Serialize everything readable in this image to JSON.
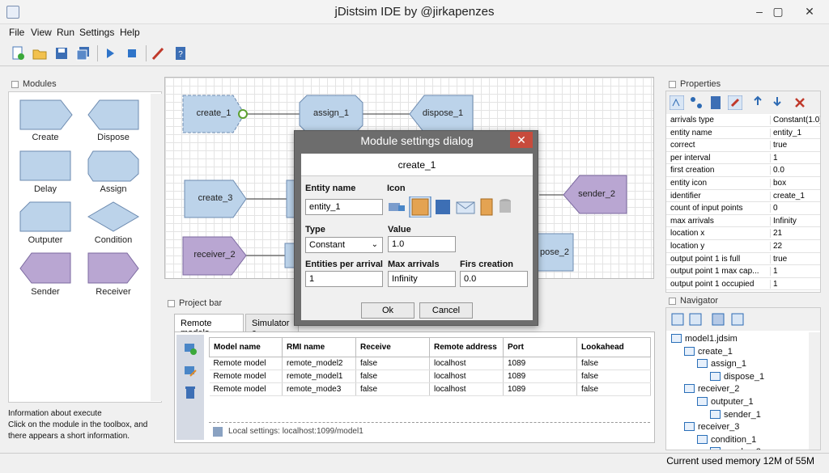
{
  "window": {
    "title": "jDistsim IDE by @jirkapenzes"
  },
  "menu": [
    "File",
    "View",
    "Run",
    "Settings",
    "Help"
  ],
  "modules_panel": {
    "title": "Modules",
    "items": [
      "Create",
      "Dispose",
      "Delay",
      "Assign",
      "Outputer",
      "Condition",
      "Sender",
      "Receiver"
    ]
  },
  "info": {
    "line1": "Information about execute",
    "line2": "Click on the module in the toolbox, and",
    "line3": "there appears a short information."
  },
  "canvas": {
    "nodes": [
      "create_1",
      "assign_1",
      "dispose_1",
      "create_3",
      "sender_2",
      "receiver_2",
      "pose_2"
    ]
  },
  "project_bar": {
    "title": "Project bar",
    "tabs": [
      "Remote models",
      "Simulator c"
    ],
    "table": {
      "headers": [
        "Model name",
        "RMI name",
        "Receive",
        "Remote address",
        "Port",
        "Lookahead"
      ],
      "rows": [
        [
          "Remote model",
          "remote_model2",
          "false",
          "localhost",
          "1089",
          "false"
        ],
        [
          "Remote model",
          "remote_model1",
          "false",
          "localhost",
          "1089",
          "false"
        ],
        [
          "Remote model",
          "remote_mode3",
          "false",
          "localhost",
          "1089",
          "false"
        ]
      ]
    },
    "local_settings": "Local settings: localhost:1099/model1"
  },
  "properties": {
    "title": "Properties",
    "rows": [
      [
        "arrivals type",
        "Constant(1.0)"
      ],
      [
        "entity name",
        "entity_1"
      ],
      [
        "correct",
        "true"
      ],
      [
        "per interval",
        "1"
      ],
      [
        "first creation",
        "0.0"
      ],
      [
        "entity icon",
        "box"
      ],
      [
        "identifier",
        "create_1"
      ],
      [
        "count of input points",
        "0"
      ],
      [
        "max arrivals",
        "Infinity"
      ],
      [
        "location x",
        "21"
      ],
      [
        "location y",
        "22"
      ],
      [
        "output point 1 is full",
        "true"
      ],
      [
        "output point 1 max cap...",
        "1"
      ],
      [
        "output point 1 occupied",
        "1"
      ]
    ]
  },
  "navigator": {
    "title": "Navigator",
    "tree": [
      {
        "label": "model1.jdsim",
        "level": 0
      },
      {
        "label": "create_1",
        "level": 1
      },
      {
        "label": "assign_1",
        "level": 2
      },
      {
        "label": "dispose_1",
        "level": 3
      },
      {
        "label": "receiver_2",
        "level": 1
      },
      {
        "label": "outputer_1",
        "level": 2
      },
      {
        "label": "sender_1",
        "level": 3
      },
      {
        "label": "receiver_3",
        "level": 1
      },
      {
        "label": "condition_1",
        "level": 2
      },
      {
        "label": "sender_2",
        "level": 3
      }
    ]
  },
  "status": {
    "memory": "Current used memory 12M of 55M"
  },
  "dialog": {
    "title": "Module settings dialog",
    "header": "create_1",
    "entity_name_label": "Entity name",
    "entity_name_value": "entity_1",
    "icon_label": "Icon",
    "type_label": "Type",
    "type_value": "Constant",
    "value_label": "Value",
    "value_value": "1.0",
    "entities_per_arrival_label": "Entities per arrival",
    "entities_per_arrival_value": "1",
    "max_arrivals_label": "Max arrivals",
    "max_arrivals_value": "Infinity",
    "first_creation_label": "Firs creation",
    "first_creation_value": "0.0",
    "ok_label": "Ok",
    "cancel_label": "Cancel"
  },
  "colors": {
    "module_blue": "#bcd3ea",
    "module_purple": "#b9a6d2",
    "dialog_close": "#c74b3c"
  }
}
